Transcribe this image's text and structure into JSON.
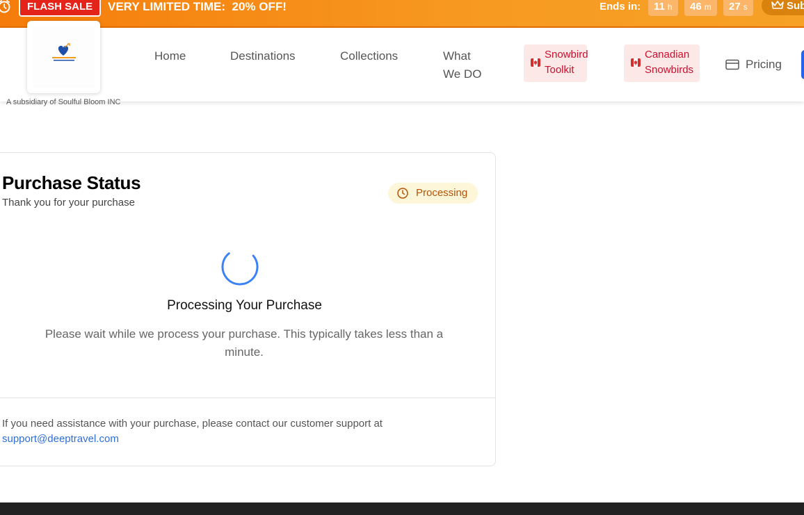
{
  "flash_sale": {
    "badge": "FLASH SALE",
    "message": "VERY LIMITED TIME:  20% OFF!",
    "ends_label": "Ends in:",
    "countdown": [
      {
        "value": "11",
        "unit": "h"
      },
      {
        "value": "46",
        "unit": "m"
      },
      {
        "value": "27",
        "unit": "s"
      }
    ],
    "subscribe_label": "Sub"
  },
  "header": {
    "logo_caption": "A subsidiary of Soulful Bloom INC",
    "nav": {
      "home": "Home",
      "destinations": "Destinations",
      "collections": "Collections",
      "what_we_do_line1": "What",
      "what_we_do_line2": "We DO",
      "snowbird_toolkit_line1": "Snowbird",
      "snowbird_toolkit_line2": "Toolkit",
      "canadian_snowbirds_line1": "Canadian",
      "canadian_snowbirds_line2": "Snowbirds",
      "pricing": "Pricing"
    }
  },
  "purchase": {
    "title": "Purchase Status",
    "subtitle": "Thank you for your purchase",
    "status": "Processing",
    "processing_title": "Processing Your Purchase",
    "processing_desc": "Please wait while we process your purchase. This typically takes less than a minute.",
    "support_text": "If you need assistance with your purchase, please contact our customer support at ",
    "support_email": "support@deeptravel.com"
  },
  "colors": {
    "flash_orange": "#f7941d",
    "sale_red": "#e4231b",
    "chip_bg": "#fde8e8",
    "chip_text": "#c8102e",
    "status_bg": "#fef6d8",
    "status_text": "#b45309",
    "spinner_blue": "#3b82f6",
    "link_blue": "#2f6fd6"
  },
  "icons": {
    "alarm": "alarm-clock-icon",
    "crown": "crown-icon",
    "flag": "canada-flag-icon",
    "card": "credit-card-icon",
    "clock": "clock-icon",
    "spinner": "loading-spinner-icon"
  }
}
